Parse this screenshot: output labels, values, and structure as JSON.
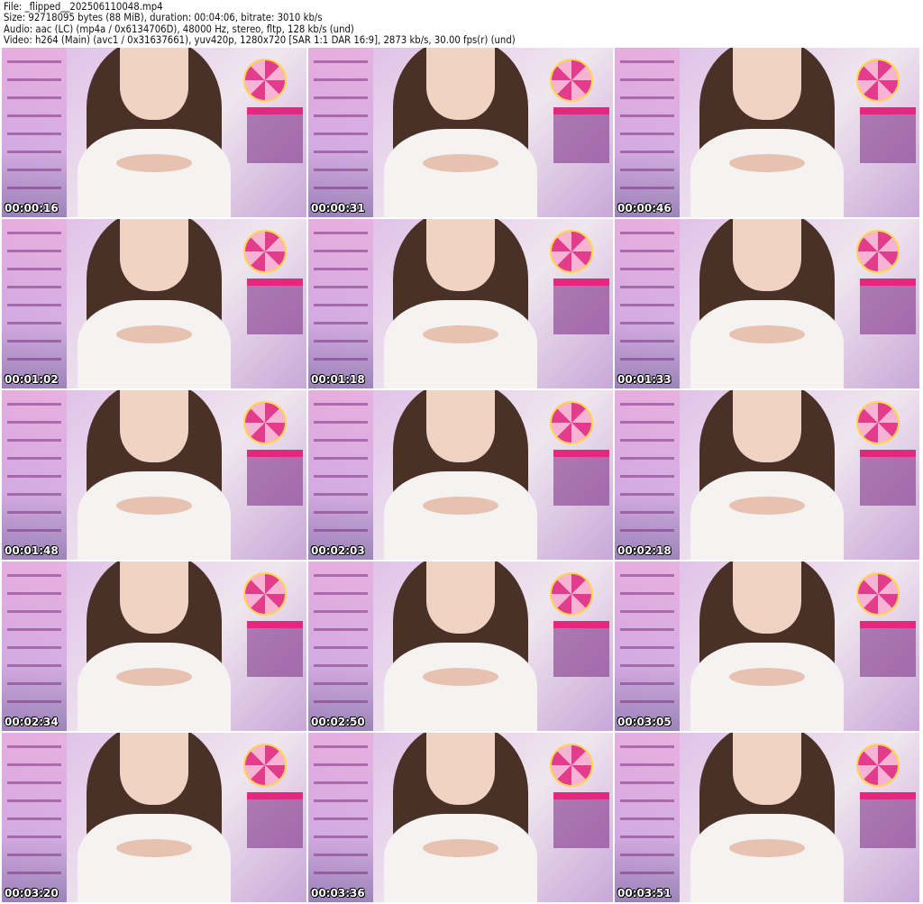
{
  "header": {
    "file": "File: _flipped__202506110048.mp4",
    "size": "Size: 92718095 bytes (88 MiB), duration: 00:04:06, bitrate: 3010 kb/s",
    "audio": "Audio: aac (LC) (mp4a / 0x6134706D), 48000 Hz, stereo, fltp, 128 kb/s (und)",
    "video": "Video: h264 (Main) (avc1 / 0x31637661), yuv420p, 1280x720 [SAR 1:1 DAR 16:9], 2873 kb/s, 30.00 fps(r) (und)"
  },
  "thumbnails": [
    {
      "timestamp": "00:00:16"
    },
    {
      "timestamp": "00:00:31"
    },
    {
      "timestamp": "00:00:46"
    },
    {
      "timestamp": "00:01:02"
    },
    {
      "timestamp": "00:01:18"
    },
    {
      "timestamp": "00:01:33"
    },
    {
      "timestamp": "00:01:48"
    },
    {
      "timestamp": "00:02:03"
    },
    {
      "timestamp": "00:02:18"
    },
    {
      "timestamp": "00:02:34"
    },
    {
      "timestamp": "00:02:50"
    },
    {
      "timestamp": "00:03:05"
    },
    {
      "timestamp": "00:03:20"
    },
    {
      "timestamp": "00:03:36"
    },
    {
      "timestamp": "00:03:51"
    }
  ]
}
